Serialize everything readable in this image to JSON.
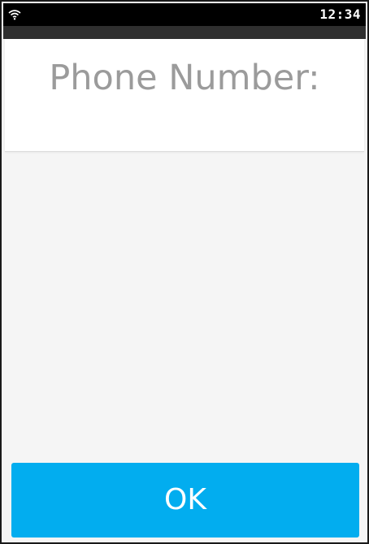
{
  "status_bar": {
    "time": "12:34",
    "wifi_icon": "wifi-icon"
  },
  "header": {
    "label": "Phone Number:",
    "value": ""
  },
  "actions": {
    "ok_label": "OK"
  },
  "colors": {
    "accent": "#02adef",
    "status_bar": "#000000",
    "label_text": "#9b9b9b",
    "background": "#f5f5f5"
  }
}
